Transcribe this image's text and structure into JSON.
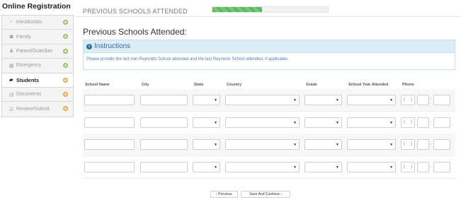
{
  "sidebar": {
    "title": "Online Registration",
    "items": [
      {
        "label": "Introduction",
        "icon": "lightbulb-icon",
        "glyph": "♀",
        "status": "complete"
      },
      {
        "label": "Family",
        "icon": "family-icon",
        "glyph": "☗",
        "status": "complete"
      },
      {
        "label": "Parent/Guardian",
        "icon": "user-icon",
        "glyph": "♟",
        "status": "complete"
      },
      {
        "label": "Emergency",
        "icon": "emergency-icon",
        "glyph": "▦",
        "status": "complete"
      },
      {
        "label": "Students",
        "icon": "graduation-cap-icon",
        "glyph": "▰",
        "status": "in-progress"
      },
      {
        "label": "Documents",
        "icon": "document-icon",
        "glyph": "▤",
        "status": "in-progress"
      },
      {
        "label": "Review/Submit",
        "icon": "list-icon",
        "glyph": "☰",
        "status": "in-progress"
      }
    ],
    "status_colors": {
      "complete": "#8fc85a",
      "in-progress": "#f3a44a"
    }
  },
  "header": {
    "page_title": "PREVIOUS SCHOOLS ATTENDED",
    "progress_percent": 43,
    "progress_label": "43%"
  },
  "section_title": "Previous Schools Attended:",
  "instructions": {
    "title": "Instructions",
    "text": "Please provide the last non-Reynolds School attended and the last Reynolds School attended, if applicable."
  },
  "table": {
    "columns": [
      "School Name",
      "City",
      "State",
      "Country",
      "Grade",
      "School Year Attended",
      "Phone"
    ],
    "row_count": 4,
    "phone_placeholder": {
      "open": "(",
      "close": ")",
      "dash": "-"
    }
  },
  "buttons": {
    "previous": "‹ Previous",
    "save_continue": "Save And Continue ›"
  }
}
